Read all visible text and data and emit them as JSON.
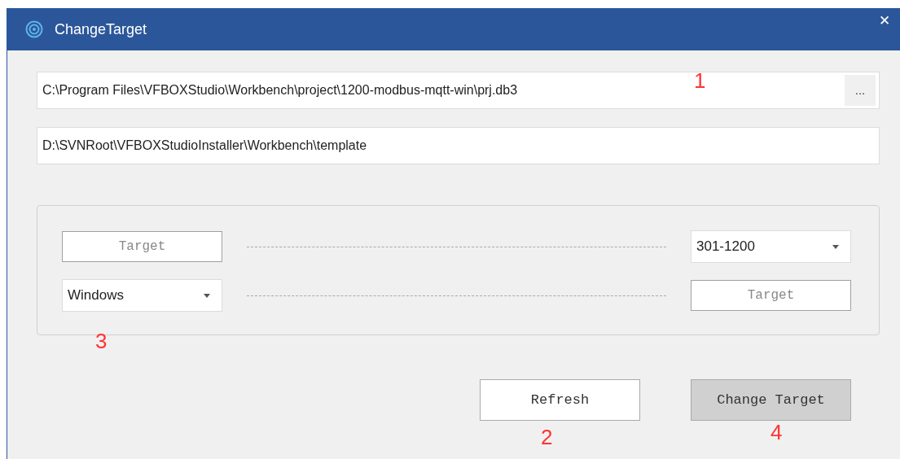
{
  "window": {
    "title": "ChangeTarget",
    "close": "✕"
  },
  "fields": [
    {
      "value": "C:\\Program Files\\VFBOXStudio\\Workbench\\project\\1200-modbus-mqtt-win\\prj.db3",
      "browse": "..."
    },
    {
      "value": "D:\\SVNRoot\\VFBOXStudioInstaller\\Workbench\\template"
    }
  ],
  "mapping_rows": [
    {
      "left": {
        "kind": "button",
        "label": "Target",
        "disabled": true
      },
      "right": {
        "kind": "select",
        "value": "301-1200"
      }
    },
    {
      "left": {
        "kind": "select",
        "value": "Windows"
      },
      "right": {
        "kind": "button",
        "label": "Target",
        "disabled": true
      }
    }
  ],
  "buttons": [
    {
      "label": "Refresh",
      "highlighted": false
    },
    {
      "label": "Change Target",
      "highlighted": true
    }
  ],
  "annotations": [
    {
      "text": "1"
    },
    {
      "text": "2"
    },
    {
      "text": "3"
    },
    {
      "text": "4"
    }
  ]
}
